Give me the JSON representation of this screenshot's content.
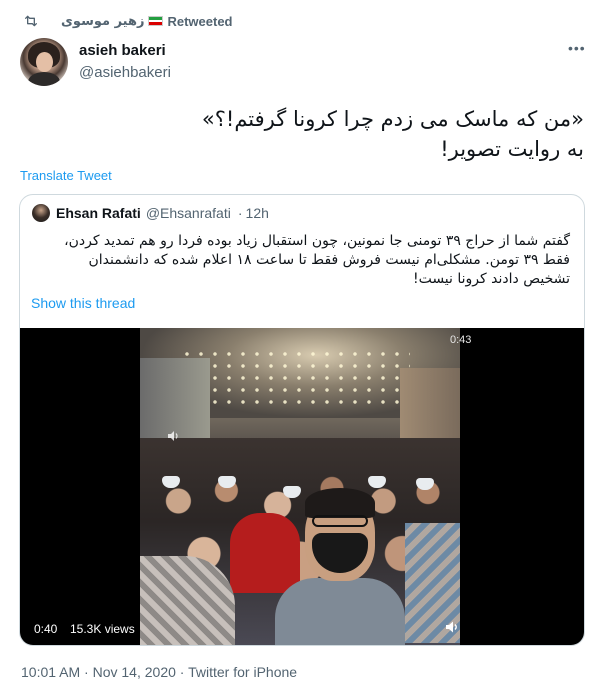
{
  "retweet": {
    "icon": "retweet-icon",
    "name": "زهیر موسوی",
    "flag": "iran-flag",
    "label": "Retweeted"
  },
  "author": {
    "display_name": "asieh bakeri",
    "handle": "@asiehbakeri",
    "avatar": "avatar-photo"
  },
  "more_menu": "•••",
  "tweet": {
    "line1": "«من که ماسک می زدم چرا کرونا گرفتم!؟»",
    "line2": "به روایت تصویر!"
  },
  "translate_link": "Translate Tweet",
  "quoted": {
    "display_name": "Ehsan Rafati",
    "handle": "@Ehsanrafati",
    "separator": "·",
    "time": "12h",
    "text": "گفتم شما از حراج ۳۹ تومنی جا نمونین، چون استقبال زیاد بوده فردا رو هم تمدید کردن، فقط ۳۹ تومن. مشکلی‌ام نیست فروش فقط تا ساعت ۱۸ اعلام شده که دانشمندان تشخیص دادند کرونا نیست!",
    "show_thread": "Show this thread",
    "video": {
      "duration": "0:43",
      "elapsed": "0:40",
      "views": "15.3K views"
    }
  },
  "footer": {
    "time": "10:01 AM",
    "sep1": " · ",
    "date": "Nov 14, 2020",
    "sep2": " · ",
    "source": "Twitter for iPhone"
  },
  "colors": {
    "link": "#1d9bf0",
    "secondary_text": "#536471",
    "border": "#cfd9de"
  }
}
